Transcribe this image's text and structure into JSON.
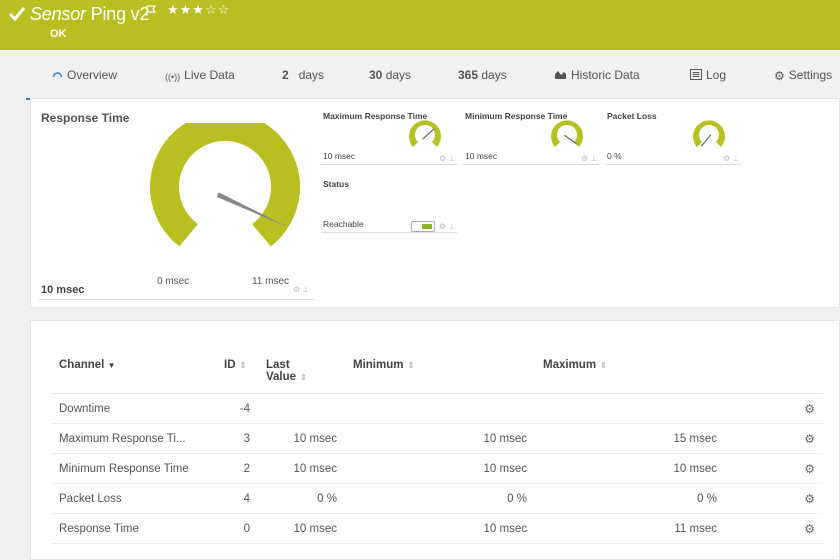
{
  "header": {
    "title_italic": "Sensor",
    "title_rest": "Ping v2",
    "stars": "★★★☆☆",
    "status": "OK"
  },
  "tabs": [
    {
      "label": "Overview",
      "icon": "overview-icon"
    },
    {
      "label": "Live Data",
      "icon": "live-data-icon"
    },
    {
      "num": "2",
      "unit": "days"
    },
    {
      "num": "30",
      "unit": "days"
    },
    {
      "num": "365",
      "unit": "days"
    },
    {
      "label": "Historic Data",
      "icon": "historic-data-icon"
    },
    {
      "label": "Log",
      "icon": "log-icon"
    },
    {
      "label": "Settings",
      "icon": "gear-icon"
    }
  ],
  "response_time": {
    "title": "Response Time",
    "value": "10 msec",
    "min_label": "0 msec",
    "max_label": "11 msec",
    "level": 0.91
  },
  "gauges": [
    {
      "label": "Maximum Response Time",
      "value": "10 msec",
      "level": 0.67
    },
    {
      "label": "Minimum Response Time",
      "value": "10 msec",
      "level": 0.95
    },
    {
      "label": "Packet Loss",
      "value": "0 %",
      "level": 0.0
    }
  ],
  "status_card": {
    "label": "Status",
    "value": "Reachable"
  },
  "colors": {
    "accent": "#b7c020",
    "tab_active": "#2f8bd8"
  },
  "table": {
    "headers": {
      "channel": "Channel",
      "id": "ID",
      "last_line1": "Last",
      "last_line2": "Value",
      "minimum": "Minimum",
      "maximum": "Maximum"
    },
    "rows": [
      {
        "channel": "Downtime",
        "id": "-4",
        "last": "",
        "min": "",
        "max": ""
      },
      {
        "channel": "Maximum Response Ti...",
        "id": "3",
        "last": "10 msec",
        "min": "10 msec",
        "max": "15 msec"
      },
      {
        "channel": "Minimum Response Time",
        "id": "2",
        "last": "10 msec",
        "min": "10 msec",
        "max": "10 msec"
      },
      {
        "channel": "Packet Loss",
        "id": "4",
        "last": "0 %",
        "min": "0 %",
        "max": "0 %"
      },
      {
        "channel": "Response Time",
        "id": "0",
        "last": "10 msec",
        "min": "10 msec",
        "max": "11 msec"
      }
    ]
  }
}
